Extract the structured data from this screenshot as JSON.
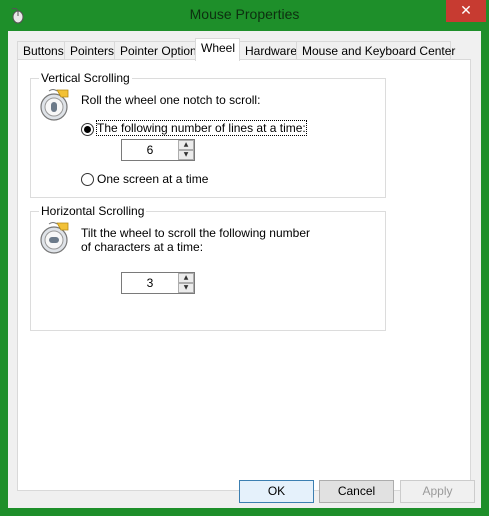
{
  "window": {
    "title": "Mouse Properties",
    "close_glyph": "✕"
  },
  "tabs": [
    {
      "label": "Buttons",
      "active": false
    },
    {
      "label": "Pointers",
      "active": false
    },
    {
      "label": "Pointer Options",
      "active": false
    },
    {
      "label": "Wheel",
      "active": true
    },
    {
      "label": "Hardware",
      "active": false
    },
    {
      "label": "Mouse and Keyboard Center",
      "active": false
    }
  ],
  "vertical": {
    "group_label": "Vertical Scrolling",
    "intro": "Roll the wheel one notch to scroll:",
    "option_lines": "The following number of lines at a time:",
    "lines_value": "6",
    "option_screen": "One screen at a time",
    "selected": "lines"
  },
  "horizontal": {
    "group_label": "Horizontal Scrolling",
    "intro_line1": "Tilt the wheel to scroll the following number",
    "intro_line2": "of characters at a time:",
    "chars_value": "3"
  },
  "buttons": {
    "ok": "OK",
    "cancel": "Cancel",
    "apply": "Apply"
  },
  "icons": {
    "app": "mouse-icon",
    "wheel": "mouse-wheel-icon",
    "up": "▲",
    "down": "▼"
  },
  "colors": {
    "frame": "#1e8f2a",
    "close": "#c73b31",
    "panel": "#ffffff",
    "dialog": "#f0f0f0"
  }
}
